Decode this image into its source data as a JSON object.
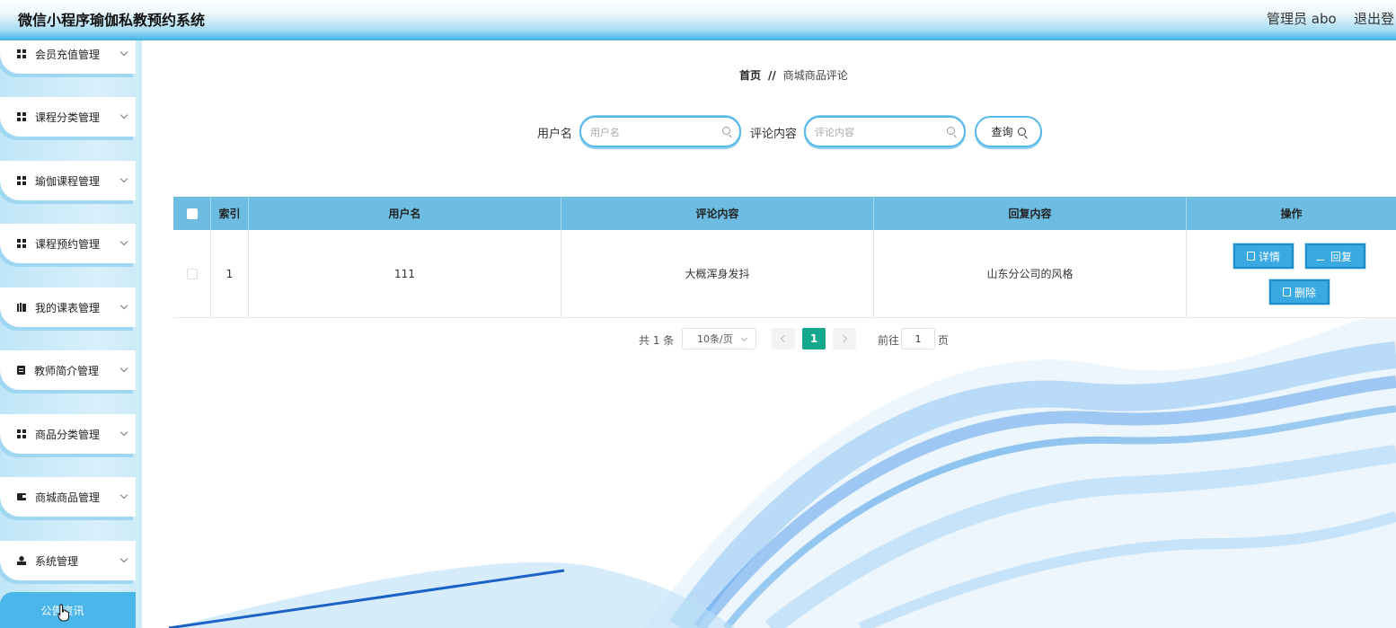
{
  "header": {
    "title": "微信小程序瑜伽私教预约系统",
    "admin": "管理员 abo",
    "logout": "退出登"
  },
  "sidebar": {
    "items": [
      {
        "label": "会员充值管理",
        "icon": "grid-icon"
      },
      {
        "label": "课程分类管理",
        "icon": "grid-icon"
      },
      {
        "label": "瑜伽课程管理",
        "icon": "grid-icon"
      },
      {
        "label": "课程预约管理",
        "icon": "grid-icon"
      },
      {
        "label": "我的课表管理",
        "icon": "bars-icon"
      },
      {
        "label": "教师简介管理",
        "icon": "clipboard-icon"
      },
      {
        "label": "商品分类管理",
        "icon": "grid-icon"
      },
      {
        "label": "商城商品管理",
        "icon": "wallet-icon"
      },
      {
        "label": "系统管理",
        "icon": "user-icon"
      }
    ],
    "active_label": "公告资讯"
  },
  "breadcrumb": {
    "home": "首页",
    "separator": "//",
    "current": "商城商品评论"
  },
  "search": {
    "username_label": "用户名",
    "username_placeholder": "用户名",
    "username_value": "",
    "content_label": "评论内容",
    "content_placeholder": "评论内容",
    "content_value": "",
    "query_label": "查询"
  },
  "table": {
    "columns": [
      "索引",
      "用户名",
      "评论内容",
      "回复内容",
      "操作"
    ],
    "rows": [
      {
        "index": "1",
        "username": "111",
        "content": "大概浑身发抖",
        "reply": "山东分公司的风格"
      }
    ],
    "actions": {
      "detail": "详情",
      "reply": "回复",
      "delete": "删除"
    }
  },
  "pagination": {
    "total": "共 1 条",
    "page_size": "10条/页",
    "current_page": "1",
    "goto_label": "前往",
    "goto_value": "1",
    "page_suffix": "页"
  },
  "colors": {
    "header_blue": "#3fb1e6",
    "table_head": "#6dbde3",
    "button_blue": "#3aa9e2",
    "pager_active": "#13a88c"
  }
}
